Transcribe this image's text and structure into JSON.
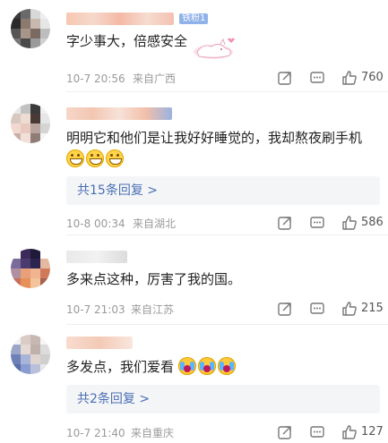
{
  "comments": [
    {
      "badge": "铁粉1",
      "text": "字少事大，倍感安全",
      "time": "10-7 20:56",
      "location": "来自广西",
      "likes": "760"
    },
    {
      "text": "明明它和他们是让我好好睡觉的，我却熬夜刷手机",
      "emojis": [
        "grin-icon",
        "grin-icon",
        "grin-icon"
      ],
      "reply_label": "共15条回复 >",
      "time": "10-8 00:34",
      "location": "来自湖北",
      "likes": "586"
    },
    {
      "text": "多来点这种，厉害了我的国。",
      "time": "10-7 21:03",
      "location": "来自江苏",
      "likes": "215"
    },
    {
      "text": "多发点，我们爱看",
      "emojis": [
        "crying-icon",
        "crying-icon",
        "crying-icon"
      ],
      "reply_label": "共2条回复 >",
      "time": "10-7 21:40",
      "location": "来自重庆",
      "likes": "127"
    }
  ],
  "colors": {
    "link": "#4a6fb5",
    "meta": "#9a9a9a",
    "badge": "#8fb2e8"
  }
}
